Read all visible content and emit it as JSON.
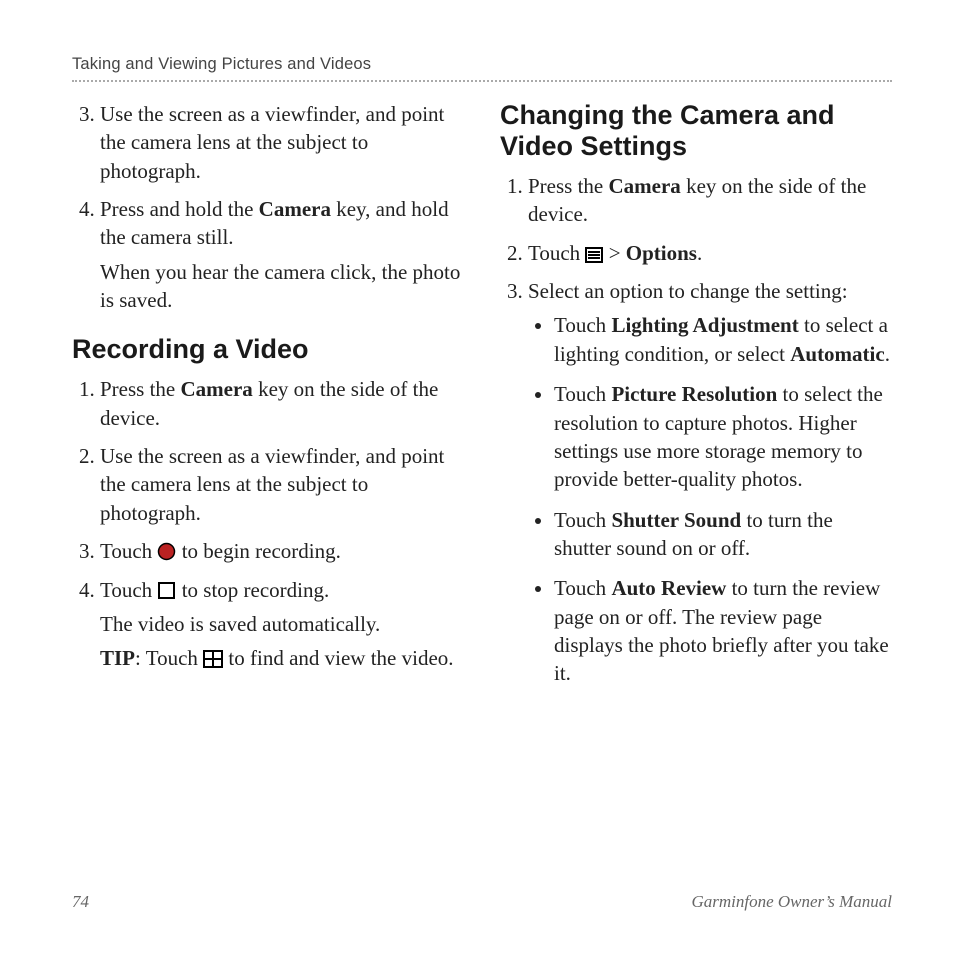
{
  "running_head": "Taking and Viewing Pictures and Videos",
  "left": {
    "cont_start": 3,
    "cont": [
      {
        "pre": "Use the screen as a viewfinder, and point the camera lens at the subject to photograph."
      },
      {
        "pre": "Press and hold the ",
        "b1": "Camera",
        "mid": " key, and hold the camera still.",
        "follow": "When you hear the camera click, the photo is saved."
      }
    ],
    "heading": "Recording a Video",
    "steps": [
      {
        "pre": "Press the ",
        "b1": "Camera",
        "post": " key on the side of the device."
      },
      {
        "pre": "Use the screen as a viewfinder, and point the camera lens at the subject to photograph."
      },
      {
        "pre": "Touch ",
        "icon": "record",
        "post": " to begin recording."
      },
      {
        "pre": "Touch ",
        "icon": "stop",
        "post": " to stop recording.",
        "follow": "The video is saved automatically.",
        "tip_lead": "TIP",
        "tip_a": ": Touch ",
        "tip_icon": "grid",
        "tip_b": " to find and view the video."
      }
    ]
  },
  "right": {
    "heading": "Changing the Camera and Video Settings",
    "steps": [
      {
        "pre": "Press the ",
        "b1": "Camera",
        "post": " key on the side of the device."
      },
      {
        "pre": "Touch ",
        "icon": "menu",
        "mid": " > ",
        "b1": "Options",
        "post": "."
      },
      {
        "pre": "Select an option to change the setting:",
        "bullets": [
          {
            "a": "Touch ",
            "b": "Lighting Adjustment",
            "c": " to select a lighting condition, or select ",
            "d": "Automatic",
            "e": "."
          },
          {
            "a": "Touch ",
            "b": "Picture Resolution",
            "c": " to select the resolution to capture photos. Higher settings use more storage memory to provide better-quality photos."
          },
          {
            "a": "Touch ",
            "b": "Shutter Sound",
            "c": " to turn the shutter sound on or off."
          },
          {
            "a": "Touch ",
            "b": "Auto Review",
            "c": " to turn the review page on or off. The review page displays the photo briefly after you take it."
          }
        ]
      }
    ]
  },
  "footer": {
    "page": "74",
    "title": "Garminfone Owner’s Manual"
  }
}
